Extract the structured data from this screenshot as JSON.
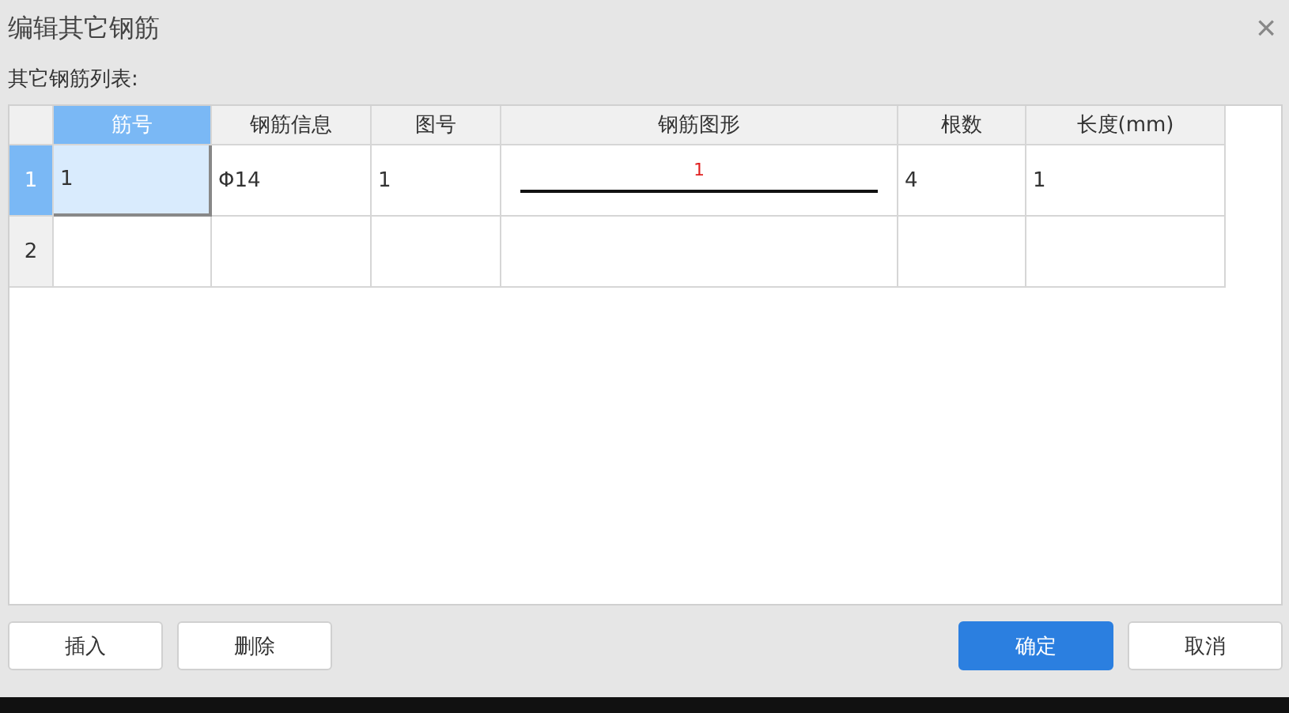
{
  "window": {
    "title": "编辑其它钢筋",
    "close": "×"
  },
  "list_label": "其它钢筋列表:",
  "table": {
    "columns": [
      {
        "label": "筋号",
        "selected": true
      },
      {
        "label": "钢筋信息",
        "selected": false
      },
      {
        "label": "图号",
        "selected": false
      },
      {
        "label": "钢筋图形",
        "selected": false
      },
      {
        "label": "根数",
        "selected": false
      },
      {
        "label": "长度(mm)",
        "selected": false
      }
    ],
    "rows": [
      {
        "number": "1",
        "selected": true,
        "cells": [
          {
            "kind": "text",
            "text": "1",
            "selected": true
          },
          {
            "kind": "text",
            "text": "Φ14",
            "selected": false
          },
          {
            "kind": "text",
            "text": "1",
            "selected": false
          },
          {
            "kind": "shape",
            "text": "1",
            "selected": false
          },
          {
            "kind": "text",
            "text": "4",
            "selected": false
          },
          {
            "kind": "text",
            "text": "1",
            "selected": false
          }
        ]
      },
      {
        "number": "2",
        "selected": false
      }
    ]
  },
  "buttons": [
    {
      "label": "插入",
      "kind": "plain"
    },
    {
      "label": "删除",
      "kind": "plain"
    },
    {
      "label": "确定",
      "kind": "primary"
    },
    {
      "label": "取消",
      "kind": "plain"
    }
  ]
}
